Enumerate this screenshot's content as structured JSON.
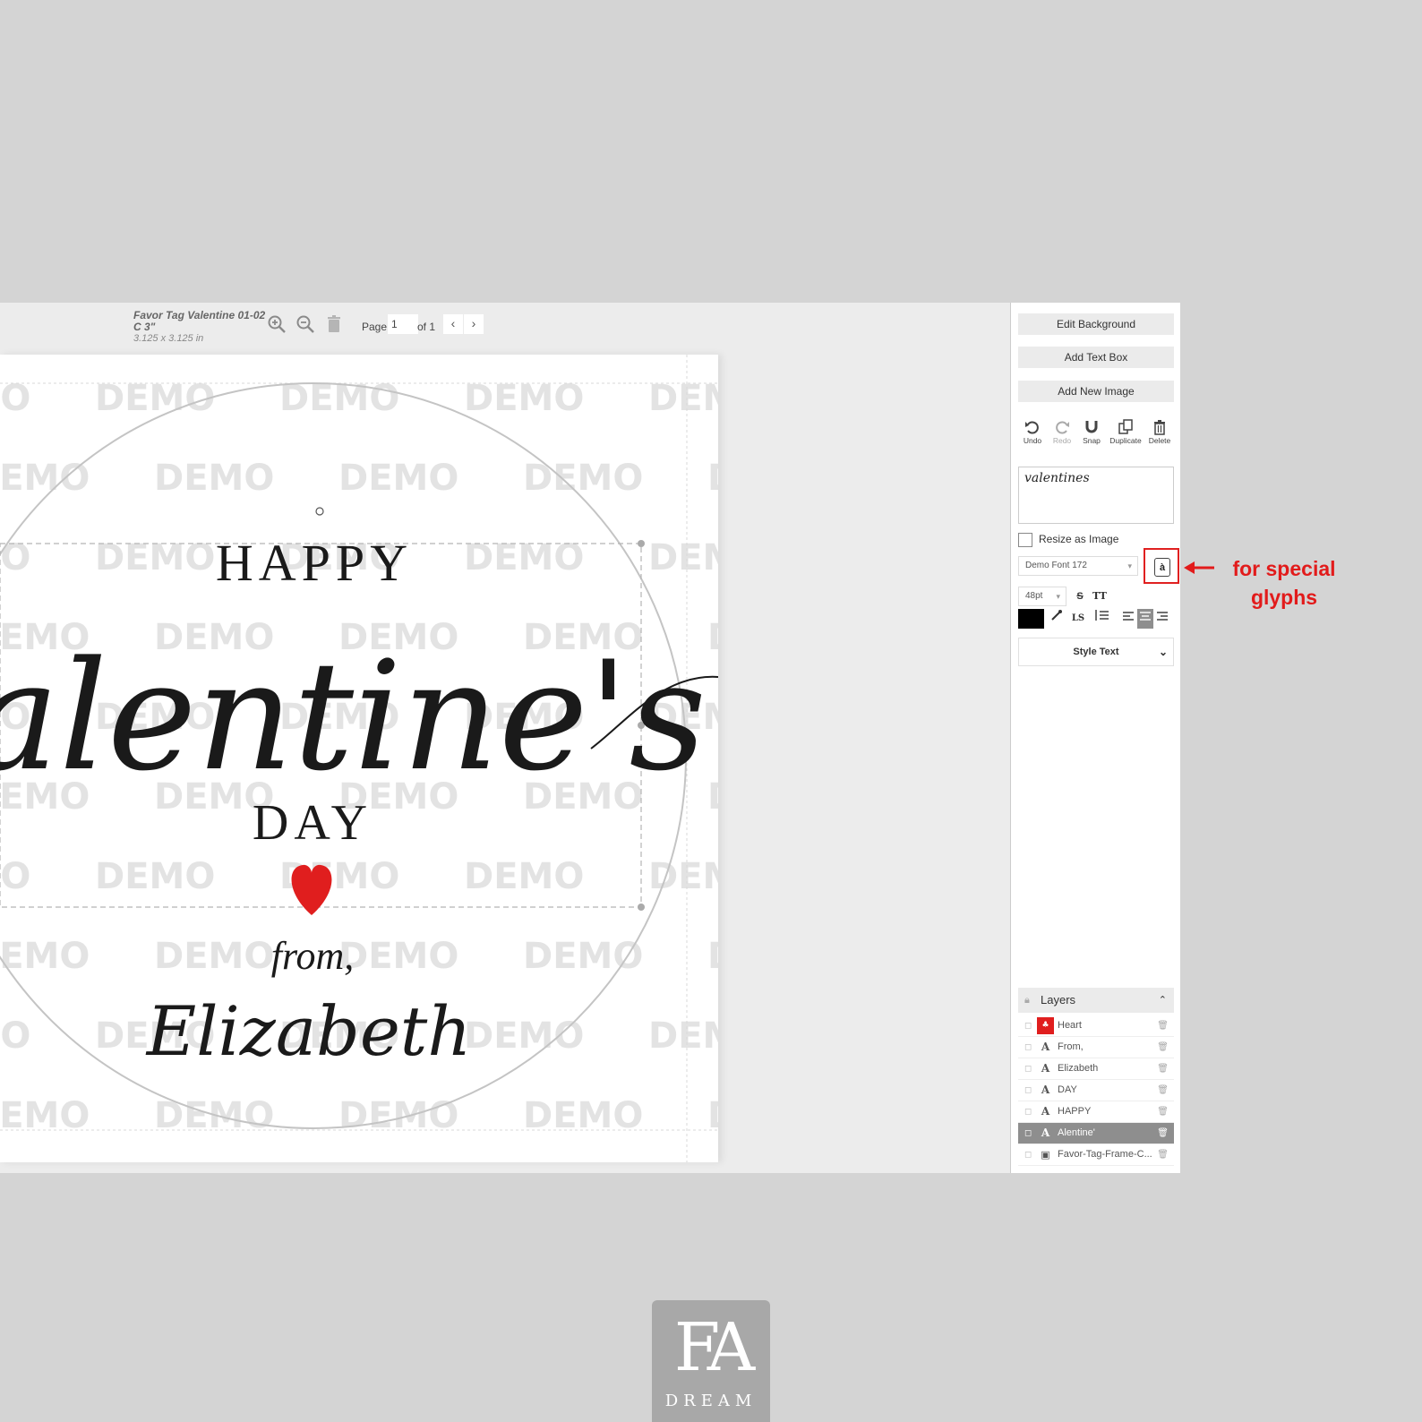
{
  "document": {
    "title": "Favor Tag Valentine 01-02 C 3\"",
    "size": "3.125 x 3.125 in"
  },
  "pagination": {
    "label": "Page",
    "current": "1",
    "of_label": "of 1",
    "prev_icon": "chevron-left-icon",
    "next_icon": "chevron-right-icon"
  },
  "toolbar_icons": [
    "zoom-in-icon",
    "zoom-out-icon",
    "trash-icon"
  ],
  "canvas": {
    "watermark": "DEMO",
    "happy": "HAPPY",
    "valentines": "valentine's",
    "day": "DAY",
    "from": "from,",
    "name": "Elizabeth",
    "heart_color": "#e01e1e"
  },
  "panel": {
    "edit_background": "Edit Background",
    "add_text_box": "Add Text Box",
    "add_new_image": "Add New Image",
    "tools": [
      {
        "label": "Undo",
        "icon": "undo-icon"
      },
      {
        "label": "Redo",
        "icon": "redo-icon"
      },
      {
        "label": "Snap",
        "icon": "magnet-icon"
      },
      {
        "label": "Duplicate",
        "icon": "duplicate-icon"
      },
      {
        "label": "Delete",
        "icon": "trash-icon"
      }
    ],
    "preview_text": "valentines",
    "resize_as_image": "Resize as Image",
    "font_name": "Demo Font 172",
    "font_size": "48pt",
    "text_color": "#000000",
    "style_text": "Style Text"
  },
  "annotation": "for special glyphs",
  "annotation_color": "#e21b1b",
  "layers": {
    "title": "Layers",
    "items": [
      {
        "name": "Heart",
        "type": "shape"
      },
      {
        "name": "From,",
        "type": "text"
      },
      {
        "name": "Elizabeth",
        "type": "text"
      },
      {
        "name": "DAY",
        "type": "text"
      },
      {
        "name": "HAPPY",
        "type": "text"
      },
      {
        "name": "Alentine'",
        "type": "text",
        "active": true
      },
      {
        "name": "Favor-Tag-Frame-C...",
        "type": "image"
      }
    ]
  },
  "logo": {
    "mark": "FA",
    "wordmark": "DREAM"
  }
}
